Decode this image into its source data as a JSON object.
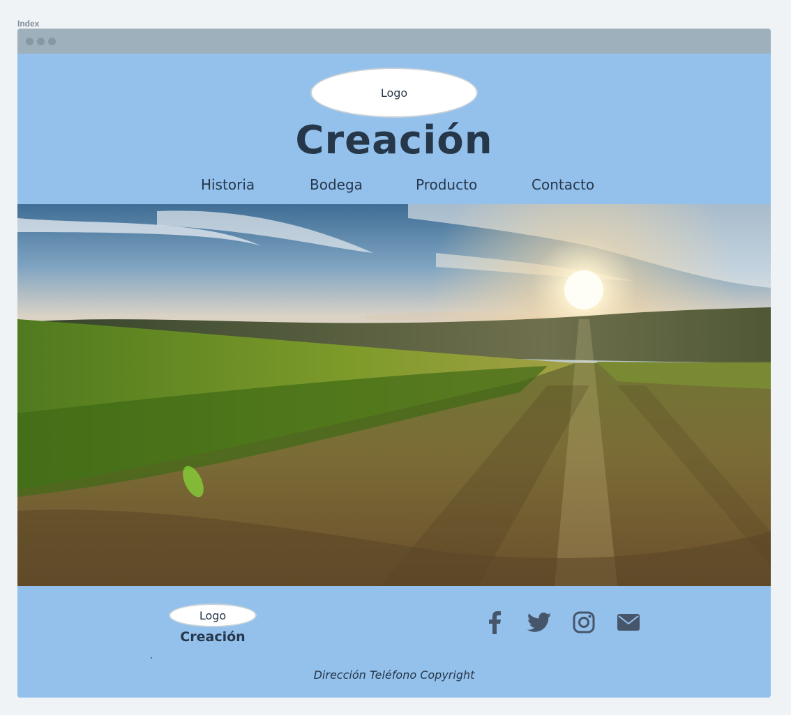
{
  "frame": {
    "label": "Index"
  },
  "header": {
    "logo_label": "Logo",
    "title": "Creación",
    "nav": [
      "Historia",
      "Bodega",
      "Producto",
      "Contacto"
    ]
  },
  "hero": {
    "icon": "vineyard-sunset-photo"
  },
  "footer": {
    "logo_label": "Logo",
    "title": "Creación",
    "social": [
      "facebook-icon",
      "twitter-icon",
      "instagram-icon",
      "mail-icon"
    ],
    "info": "Dirección Teléfono Copyright"
  },
  "colors": {
    "background": "#eff3f6",
    "panel": "#93c1ec",
    "text": "#27374a",
    "titlebar": "#9fb0bd"
  }
}
